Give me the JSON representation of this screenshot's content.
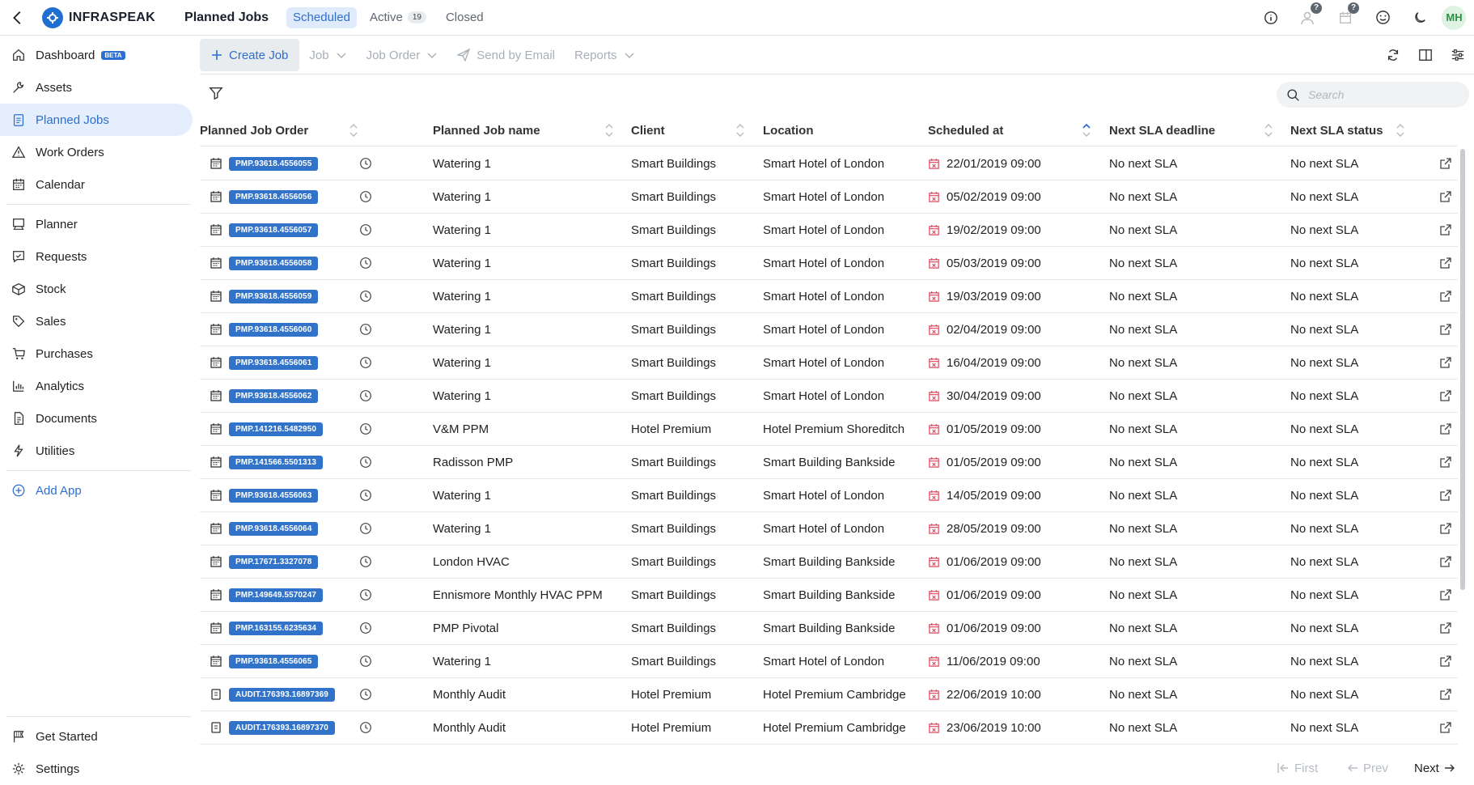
{
  "app": {
    "brand": "INFRASPEAK",
    "page_title": "Planned Jobs"
  },
  "top_tabs": [
    {
      "label": "Scheduled",
      "active": true
    },
    {
      "label": "Active",
      "count": "19"
    },
    {
      "label": "Closed"
    }
  ],
  "top_icons": {
    "user_badge": "?",
    "calendar_badge": "?",
    "avatar": "MH"
  },
  "sidebar": {
    "items": [
      {
        "label": "Dashboard",
        "icon": "home-icon",
        "badge": "BETA"
      },
      {
        "label": "Assets",
        "icon": "wrench-icon"
      },
      {
        "label": "Planned Jobs",
        "icon": "clipboard-icon",
        "active": true
      },
      {
        "label": "Work Orders",
        "icon": "warning-icon"
      },
      {
        "label": "Calendar",
        "icon": "calendar-icon"
      },
      {
        "label": "Planner",
        "icon": "planner-icon"
      },
      {
        "label": "Requests",
        "icon": "request-icon"
      },
      {
        "label": "Stock",
        "icon": "box-icon"
      },
      {
        "label": "Sales",
        "icon": "tag-icon"
      },
      {
        "label": "Purchases",
        "icon": "cart-icon"
      },
      {
        "label": "Analytics",
        "icon": "chart-icon"
      },
      {
        "label": "Documents",
        "icon": "document-icon"
      },
      {
        "label": "Utilities",
        "icon": "bolt-icon"
      }
    ],
    "add_app": "Add App",
    "bottom": [
      {
        "label": "Get Started",
        "icon": "flag-icon"
      },
      {
        "label": "Settings",
        "icon": "gear-icon"
      }
    ]
  },
  "toolbar": {
    "create": "Create Job",
    "job": "Job",
    "job_order": "Job Order",
    "send_email": "Send by Email",
    "reports": "Reports"
  },
  "search": {
    "placeholder": "Search"
  },
  "table": {
    "columns": [
      "Planned Job Order",
      "Planned Job name",
      "Client",
      "Location",
      "Scheduled at",
      "Next SLA deadline",
      "Next SLA status"
    ],
    "sorted_column": "Scheduled at",
    "rows": [
      {
        "order": "PMP.93618.4556055",
        "name": "Watering 1",
        "client": "Smart Buildings",
        "location": "Smart Hotel of London",
        "scheduled": "22/01/2019 09:00",
        "deadline": "No next SLA",
        "status": "No next SLA"
      },
      {
        "order": "PMP.93618.4556056",
        "name": "Watering 1",
        "client": "Smart Buildings",
        "location": "Smart Hotel of London",
        "scheduled": "05/02/2019 09:00",
        "deadline": "No next SLA",
        "status": "No next SLA"
      },
      {
        "order": "PMP.93618.4556057",
        "name": "Watering 1",
        "client": "Smart Buildings",
        "location": "Smart Hotel of London",
        "scheduled": "19/02/2019 09:00",
        "deadline": "No next SLA",
        "status": "No next SLA"
      },
      {
        "order": "PMP.93618.4556058",
        "name": "Watering 1",
        "client": "Smart Buildings",
        "location": "Smart Hotel of London",
        "scheduled": "05/03/2019 09:00",
        "deadline": "No next SLA",
        "status": "No next SLA"
      },
      {
        "order": "PMP.93618.4556059",
        "name": "Watering 1",
        "client": "Smart Buildings",
        "location": "Smart Hotel of London",
        "scheduled": "19/03/2019 09:00",
        "deadline": "No next SLA",
        "status": "No next SLA"
      },
      {
        "order": "PMP.93618.4556060",
        "name": "Watering 1",
        "client": "Smart Buildings",
        "location": "Smart Hotel of London",
        "scheduled": "02/04/2019 09:00",
        "deadline": "No next SLA",
        "status": "No next SLA"
      },
      {
        "order": "PMP.93618.4556061",
        "name": "Watering 1",
        "client": "Smart Buildings",
        "location": "Smart Hotel of London",
        "scheduled": "16/04/2019 09:00",
        "deadline": "No next SLA",
        "status": "No next SLA"
      },
      {
        "order": "PMP.93618.4556062",
        "name": "Watering 1",
        "client": "Smart Buildings",
        "location": "Smart Hotel of London",
        "scheduled": "30/04/2019 09:00",
        "deadline": "No next SLA",
        "status": "No next SLA"
      },
      {
        "order": "PMP.141216.5482950",
        "name": "V&M PPM",
        "client": "Hotel Premium",
        "location": "Hotel Premium Shoreditch",
        "scheduled": "01/05/2019 09:00",
        "deadline": "No next SLA",
        "status": "No next SLA"
      },
      {
        "order": "PMP.141566.5501313",
        "name": "Radisson PMP",
        "client": "Smart Buildings",
        "location": "Smart Building Bankside",
        "scheduled": "01/05/2019 09:00",
        "deadline": "No next SLA",
        "status": "No next SLA"
      },
      {
        "order": "PMP.93618.4556063",
        "name": "Watering 1",
        "client": "Smart Buildings",
        "location": "Smart Hotel of London",
        "scheduled": "14/05/2019 09:00",
        "deadline": "No next SLA",
        "status": "No next SLA"
      },
      {
        "order": "PMP.93618.4556064",
        "name": "Watering 1",
        "client": "Smart Buildings",
        "location": "Smart Hotel of London",
        "scheduled": "28/05/2019 09:00",
        "deadline": "No next SLA",
        "status": "No next SLA"
      },
      {
        "order": "PMP.17671.3327078",
        "name": "London HVAC",
        "client": "Smart Buildings",
        "location": "Smart Building Bankside",
        "scheduled": "01/06/2019 09:00",
        "deadline": "No next SLA",
        "status": "No next SLA"
      },
      {
        "order": "PMP.149649.5570247",
        "name": "Ennismore Monthly HVAC PPM",
        "client": "Smart Buildings",
        "location": "Smart Building Bankside",
        "scheduled": "01/06/2019 09:00",
        "deadline": "No next SLA",
        "status": "No next SLA"
      },
      {
        "order": "PMP.163155.6235634",
        "name": "PMP Pivotal",
        "client": "Smart Buildings",
        "location": "Smart Building Bankside",
        "scheduled": "01/06/2019 09:00",
        "deadline": "No next SLA",
        "status": "No next SLA"
      },
      {
        "order": "PMP.93618.4556065",
        "name": "Watering 1",
        "client": "Smart Buildings",
        "location": "Smart Hotel of London",
        "scheduled": "11/06/2019 09:00",
        "deadline": "No next SLA",
        "status": "No next SLA"
      },
      {
        "order": "AUDIT.176393.16897369",
        "name": "Monthly Audit",
        "client": "Hotel Premium",
        "location": "Hotel Premium Cambridge",
        "scheduled": "22/06/2019 10:00",
        "deadline": "No next SLA",
        "status": "No next SLA"
      },
      {
        "order": "AUDIT.176393.16897370",
        "name": "Monthly Audit",
        "client": "Hotel Premium",
        "location": "Hotel Premium Cambridge",
        "scheduled": "23/06/2019 10:00",
        "deadline": "No next SLA",
        "status": "No next SLA"
      }
    ]
  },
  "pagination": {
    "first": "First",
    "prev": "Prev",
    "next": "Next"
  },
  "colors": {
    "accent": "#2d6fd1",
    "tag": "#3173c9",
    "date_icon": "#e0445c",
    "active_nav_bg": "#e4eefc"
  }
}
